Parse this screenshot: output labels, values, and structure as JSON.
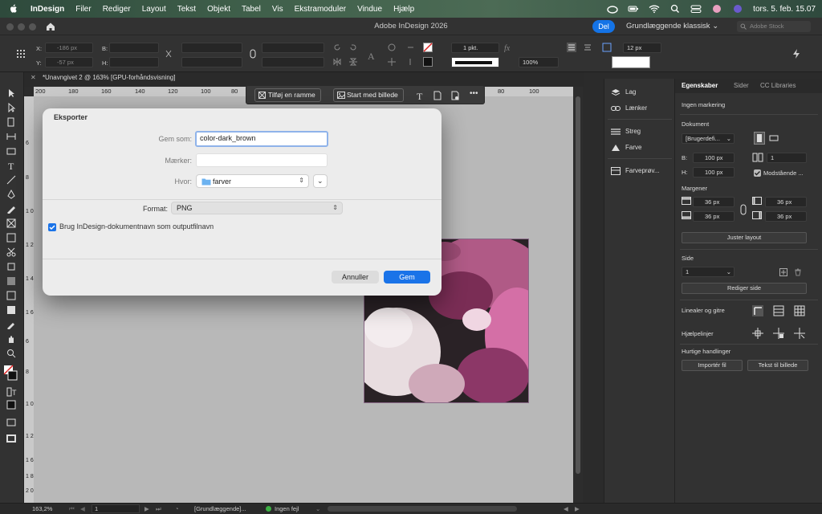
{
  "menubar": {
    "app_name": "InDesign",
    "items": [
      "Filer",
      "Rediger",
      "Layout",
      "Tekst",
      "Objekt",
      "Tabel",
      "Vis",
      "Ekstramoduler",
      "Vindue",
      "Hjælp"
    ],
    "datetime": "tors. 5. feb. 15.07"
  },
  "appbar": {
    "title": "Adobe InDesign 2026",
    "share_label": "Del",
    "workspace": "Grundlæggende klassisk",
    "stock_placeholder": "Adobe Stock"
  },
  "control": {
    "x_label": "X:",
    "x_value": "-186 px",
    "y_label": "Y:",
    "y_value": "-57 px",
    "b_label": "B:",
    "h_label": "H:",
    "stroke_weight": "1 pkt.",
    "zoom_pct": "100%",
    "font_size": "12 px"
  },
  "document": {
    "tab": "*Unavngivet 2 @ 163% [GPU-forhåndsvisning]",
    "ruler_h": [
      "200",
      "180",
      "160",
      "140",
      "120",
      "100",
      "80",
      "80",
      "100"
    ],
    "ruler_v": [
      "6",
      "8",
      "1 0",
      "1 2",
      "1 4",
      "1 6",
      "6",
      "8",
      "1 0",
      "1 2",
      "1 6",
      "1 8",
      "2 0"
    ]
  },
  "frame_toolbar": {
    "add_frame": "Tilføj en ramme",
    "start_image": "Start med billede"
  },
  "dialog": {
    "title": "Eksporter",
    "save_as_label": "Gem som:",
    "save_as_value": "color-dark_brown",
    "tags_label": "Mærker:",
    "where_label": "Hvor:",
    "where_value": "farver",
    "format_label": "Format:",
    "format_value": "PNG",
    "checkbox_label": "Brug InDesign-dokumentnavn som outputfilnavn",
    "cancel_label": "Annuller",
    "save_label": "Gem"
  },
  "panel_icons": [
    "Lag",
    "Lænker",
    "Streg",
    "Farve",
    "Farveprøv..."
  ],
  "properties": {
    "tabs": [
      "Egenskaber",
      "Sider",
      "CC Libraries"
    ],
    "no_selection": "Ingen markering",
    "document_label": "Dokument",
    "preset": "[Brugerdefi...",
    "b_label": "B:",
    "b_value": "100 px",
    "h_label": "H:",
    "h_value": "100 px",
    "pages_value": "1",
    "facing_label": "Modstående ...",
    "margins_label": "Margener",
    "margin_values": [
      "36 px",
      "36 px",
      "36 px",
      "36 px"
    ],
    "adjust_layout": "Juster layout",
    "page_label": "Side",
    "page_value": "1",
    "edit_page": "Rediger side",
    "rulers_grids": "Linealer og gitre",
    "guides": "Hjælpelinjer",
    "quick_actions": "Hurtige handlinger",
    "import_file": "Importér fil",
    "text_to_image": "Tekst til billede"
  },
  "status": {
    "zoom": "163,2%",
    "page": "1",
    "style": "[Grundlæggende]...",
    "errors": "Ingen fejl"
  },
  "colors": {
    "accent": "#1473e6",
    "dialog_bg": "#ececec",
    "panel_bg": "#323232",
    "canvas_bg": "#b8b8b8",
    "ok_green": "#3cb043"
  }
}
